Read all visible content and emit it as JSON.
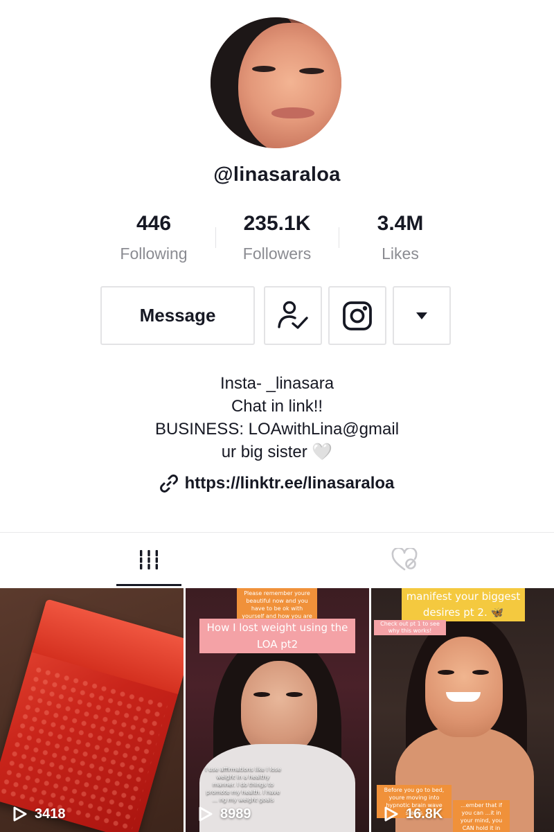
{
  "profile": {
    "username": "@linasaraloa"
  },
  "stats": [
    {
      "value": "446",
      "label": "Following"
    },
    {
      "value": "235.1K",
      "label": "Followers"
    },
    {
      "value": "3.4M",
      "label": "Likes"
    }
  ],
  "actions": {
    "message_label": "Message",
    "follow_icon": "user-check-icon",
    "instagram_icon": "instagram-icon",
    "more_icon": "caret-down-icon"
  },
  "bio": {
    "lines": [
      "Insta- _linasara",
      "Chat in link!!",
      "BUSINESS: LOAwithLina@gmail",
      "ur big sister 🤍"
    ],
    "link": "https://linktr.ee/linasaraloa"
  },
  "tabs": [
    {
      "name": "videos",
      "icon": "grid-icon",
      "active": true
    },
    {
      "name": "liked",
      "icon": "heart-lock-icon",
      "active": false
    }
  ],
  "videos": [
    {
      "plays": "3418",
      "captions": []
    },
    {
      "plays": "8989",
      "captions": [
        "Please remember youre beautiful now and you have to be ok with yourself and how you are right now.",
        "How I lost weight using the LOA pt2",
        "I use affirmations like I lose weight in a healthy manner. I do things to promote my health. I have ... ng my weight goals"
      ]
    },
    {
      "plays": "16.8K",
      "captions": [
        "manifest your biggest desires pt 2. 🦋",
        "Check out pt 1 to see why this works!",
        "Before you go to bed, youre moving into hypnotic brain wave states",
        "...ember that if you can ...it in your mind, you CAN hold it in your hand. But if its not this, its always"
      ]
    }
  ]
}
